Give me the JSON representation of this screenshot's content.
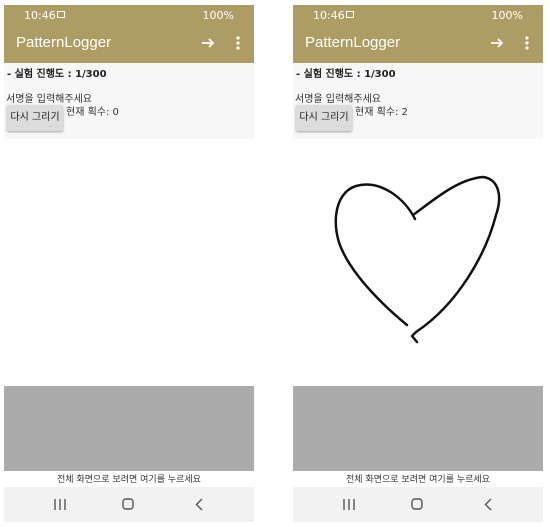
{
  "screens": [
    {
      "status_time": "10:46",
      "status_battery": "100%",
      "app_title": "PatternLogger",
      "progress_text": "- 실험 진행도 : 1/300",
      "prompt_text": "서명을 입력해주세요",
      "redraw_label": "다시 그리기",
      "count_text": "현재 획수: 0",
      "fullscreen_hint": "전체 화면으로 보려면 여기를 누르세요",
      "has_drawing": false
    },
    {
      "status_time": "10:46",
      "status_battery": "100%",
      "app_title": "PatternLogger",
      "progress_text": "- 실험 진행도 : 1/300",
      "prompt_text": "서명을 입력해주세요",
      "redraw_label": "다시 그리기",
      "count_text": "현재 획수: 2",
      "fullscreen_hint": "전체 화면으로 보려면 여기를 누르세요",
      "has_drawing": true
    }
  ],
  "icons": {
    "forward": "arrow-right-icon",
    "overflow": "more-vertical-icon",
    "recent_apps": "recent-apps-icon",
    "home": "home-icon",
    "back": "back-icon"
  },
  "colors": {
    "app_bar": "#ad9d65",
    "bottom_panel": "#ababab"
  }
}
